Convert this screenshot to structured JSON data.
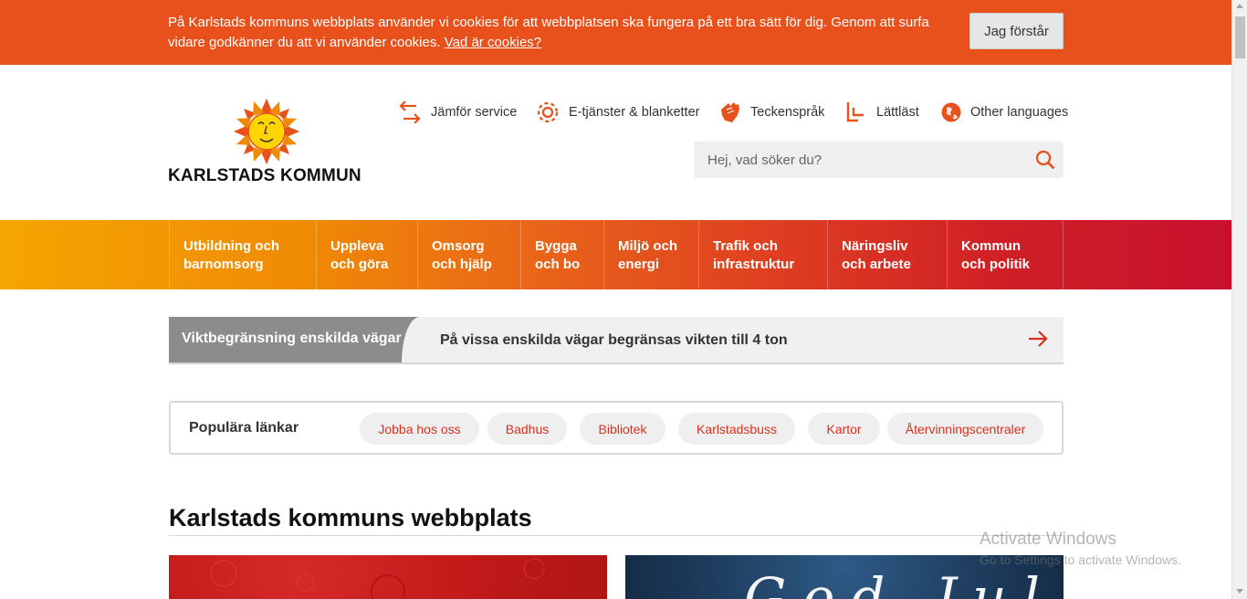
{
  "cookie": {
    "text": "På Karlstads kommuns webbplats använder vi cookies för att webbplatsen ska fungera på ett bra sätt för dig. Genom att surfa vidare godkänner du att vi använder cookies. ",
    "link": "Vad är cookies?",
    "button": "Jag förstår"
  },
  "logo": {
    "text": "KARLSTADS KOMMUN"
  },
  "toplinks": [
    {
      "label": "Jämför service",
      "icon": "compare-arrows-icon"
    },
    {
      "label": "E-tjänster & blanketter",
      "icon": "gear-icon"
    },
    {
      "label": "Teckenspråk",
      "icon": "sign-language-hand-icon"
    },
    {
      "label": "Lättläst",
      "icon": "easy-read-icon"
    },
    {
      "label": "Other languages",
      "icon": "globe-icon"
    }
  ],
  "search": {
    "placeholder": "Hej, vad söker du?"
  },
  "nav": [
    {
      "line1": "Utbildning och",
      "line2": "barnomsorg"
    },
    {
      "line1": "Uppleva",
      "line2": "och göra"
    },
    {
      "line1": "Omsorg",
      "line2": "och hjälp"
    },
    {
      "line1": "Bygga",
      "line2": "och bo"
    },
    {
      "line1": "Miljö och",
      "line2": "energi"
    },
    {
      "line1": "Trafik och",
      "line2": "infrastruktur"
    },
    {
      "line1": "Näringsliv",
      "line2": "och arbete"
    },
    {
      "line1": "Kommun",
      "line2": "och politik"
    }
  ],
  "news": {
    "label": "Viktbegränsning enskilda vägar",
    "text": "På vissa enskilda vägar begränsas vikten till 4 ton"
  },
  "popular": {
    "title": "Populära länkar",
    "links": [
      "Jobba hos oss",
      "Badhus",
      "Bibliotek",
      "Karlstadsbuss",
      "Kartor",
      "Återvinningscentraler"
    ]
  },
  "heading": "Karlstads kommuns webbplats",
  "cards": {
    "blue_text": "God Jul"
  },
  "watermark": {
    "title": "Activate Windows",
    "subtitle": "Go to Settings to activate Windows."
  },
  "colors": {
    "accent": "#e8511c",
    "link_red": "#d9301e",
    "nav_start": "#f5a500",
    "nav_end": "#c8102e",
    "news_label_bg": "#8c8c8c"
  }
}
